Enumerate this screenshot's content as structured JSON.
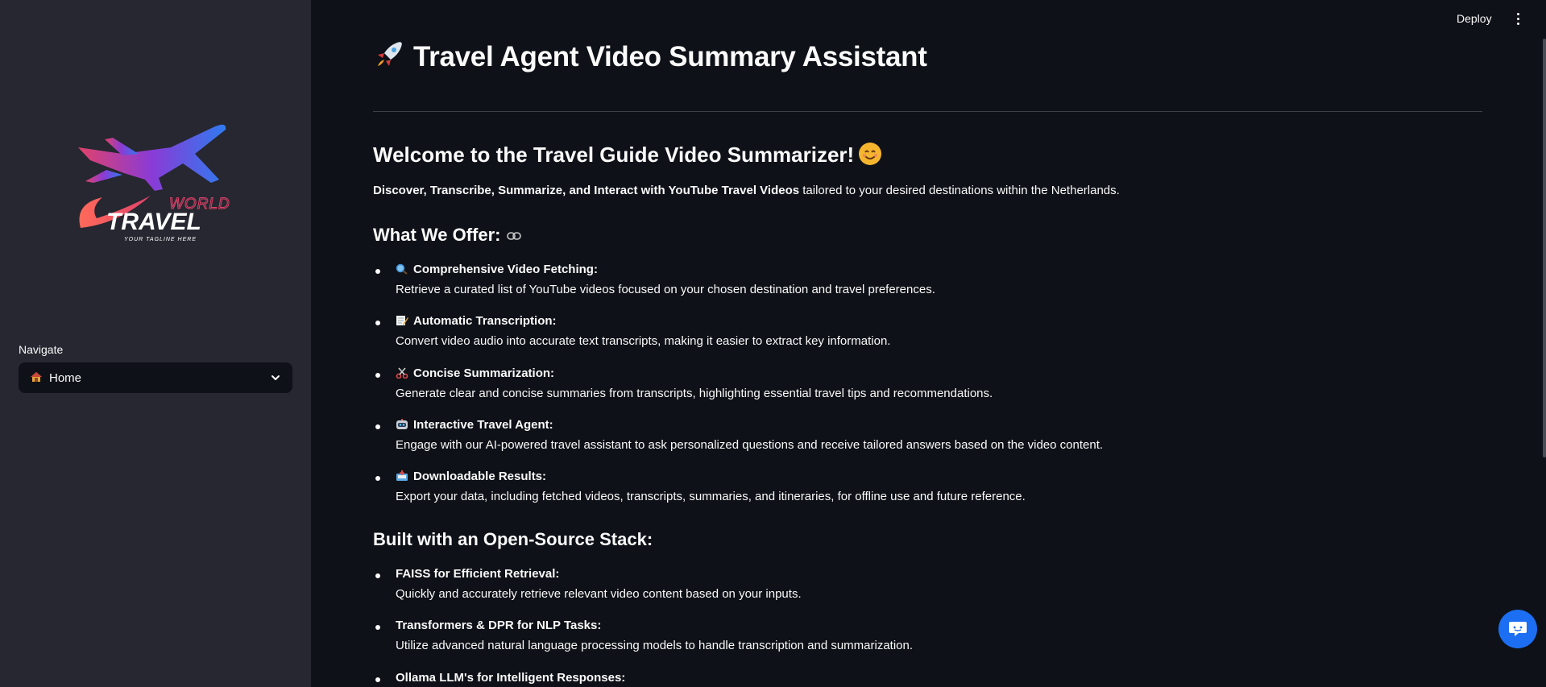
{
  "header": {
    "deploy_label": "Deploy"
  },
  "sidebar": {
    "logo": {
      "line1": "WORLD",
      "line2": "TRAVEL",
      "tagline": "YOUR TAGLINE HERE"
    },
    "nav_label": "Navigate",
    "nav_selected": "Home",
    "nav_icon": "house-icon"
  },
  "main": {
    "title": "Travel Agent Video Summary Assistant",
    "welcome_heading": "Welcome to the Travel Guide Video Summarizer!",
    "intro_bold": "Discover, Transcribe, Summarize, and Interact with YouTube Travel Videos",
    "intro_rest": " tailored to your desired destinations within the Netherlands.",
    "offer_heading": "What We Offer:",
    "offers": [
      {
        "icon": "magnifier-icon",
        "title": "Comprehensive Video Fetching:",
        "desc": "Retrieve a curated list of YouTube videos focused on your chosen destination and travel preferences."
      },
      {
        "icon": "memo-icon",
        "title": "Automatic Transcription:",
        "desc": "Convert video audio into accurate text transcripts, making it easier to extract key information."
      },
      {
        "icon": "scissors-icon",
        "title": "Concise Summarization:",
        "desc": "Generate clear and concise summaries from transcripts, highlighting essential travel tips and recommendations."
      },
      {
        "icon": "robot-icon",
        "title": "Interactive Travel Agent:",
        "desc": "Engage with our AI-powered travel assistant to ask personalized questions and receive tailored answers based on the video content."
      },
      {
        "icon": "inbox-icon",
        "title": "Downloadable Results:",
        "desc": "Export your data, including fetched videos, transcripts, summaries, and itineraries, for offline use and future reference."
      }
    ],
    "stack_heading": "Built with an Open-Source Stack:",
    "stack": [
      {
        "title": "FAISS for Efficient Retrieval:",
        "desc": "Quickly and accurately retrieve relevant video content based on your inputs."
      },
      {
        "title": "Transformers & DPR for NLP Tasks:",
        "desc": "Utilize advanced natural language processing models to handle transcription and summarization."
      },
      {
        "title": "Ollama LLM's for Intelligent Responses:",
        "desc": ""
      }
    ]
  }
}
